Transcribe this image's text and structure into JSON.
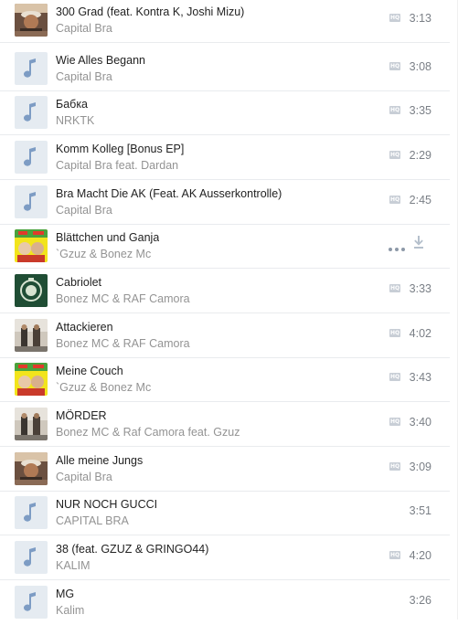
{
  "tracks": [
    {
      "title": "300 Grad (feat. Kontra K, Joshi Mizu)",
      "artist": "Capital Bra",
      "duration": "3:13",
      "hq": true,
      "cover": "art-capital"
    },
    {
      "title": "Wie Alles Begann",
      "artist": "Capital Bra",
      "duration": "3:08",
      "hq": true,
      "cover": "note"
    },
    {
      "title": "Бабка",
      "artist": "NRKTK",
      "duration": "3:35",
      "hq": true,
      "cover": "note"
    },
    {
      "title": "Komm Kolleg [Bonus EP]",
      "artist": "Capital Bra feat. Dardan",
      "duration": "2:29",
      "hq": true,
      "cover": "note"
    },
    {
      "title": "Bra Macht Die AK (Feat. AK Ausserkontrolle)",
      "artist": "Capital Bra",
      "duration": "2:45",
      "hq": true,
      "cover": "note"
    },
    {
      "title": "Blättchen und Ganja",
      "artist": "`Gzuz & Bonez Mc",
      "duration": "",
      "hq": false,
      "hover": true,
      "cover": "art-yellow"
    },
    {
      "title": "Cabriolet",
      "artist": "Bonez MC & RAF Camora",
      "duration": "3:33",
      "hq": true,
      "cover": "art-green"
    },
    {
      "title": "Attackieren",
      "artist": "Bonez MC & RAF Camora",
      "duration": "4:02",
      "hq": true,
      "cover": "art-street"
    },
    {
      "title": "Meine Couch",
      "artist": "`Gzuz & Bonez Mc",
      "duration": "3:43",
      "hq": true,
      "cover": "art-yellow"
    },
    {
      "title": "MÖRDER",
      "artist": "Bonez MC & Raf Camora feat. Gzuz",
      "duration": "3:40",
      "hq": true,
      "cover": "art-street"
    },
    {
      "title": "Alle meine Jungs",
      "artist": "Capital Bra",
      "duration": "3:09",
      "hq": true,
      "cover": "art-capital"
    },
    {
      "title": "NUR NOCH GUCCI",
      "artist": "CAPITAL BRA",
      "duration": "3:51",
      "hq": false,
      "cover": "note"
    },
    {
      "title": "38 (feat. GZUZ & GRINGO44)",
      "artist": "KALIM",
      "duration": "4:20",
      "hq": true,
      "cover": "note"
    },
    {
      "title": "MG",
      "artist": "Kalim",
      "duration": "3:26",
      "hq": false,
      "cover": "note"
    }
  ],
  "labels": {
    "hq_badge": "HQ"
  },
  "colors": {
    "note_bg": "#e5ebf1",
    "note_fg": "#7d9cc4",
    "title": "#222222",
    "artist": "#939393",
    "duration": "#7a7f86"
  }
}
